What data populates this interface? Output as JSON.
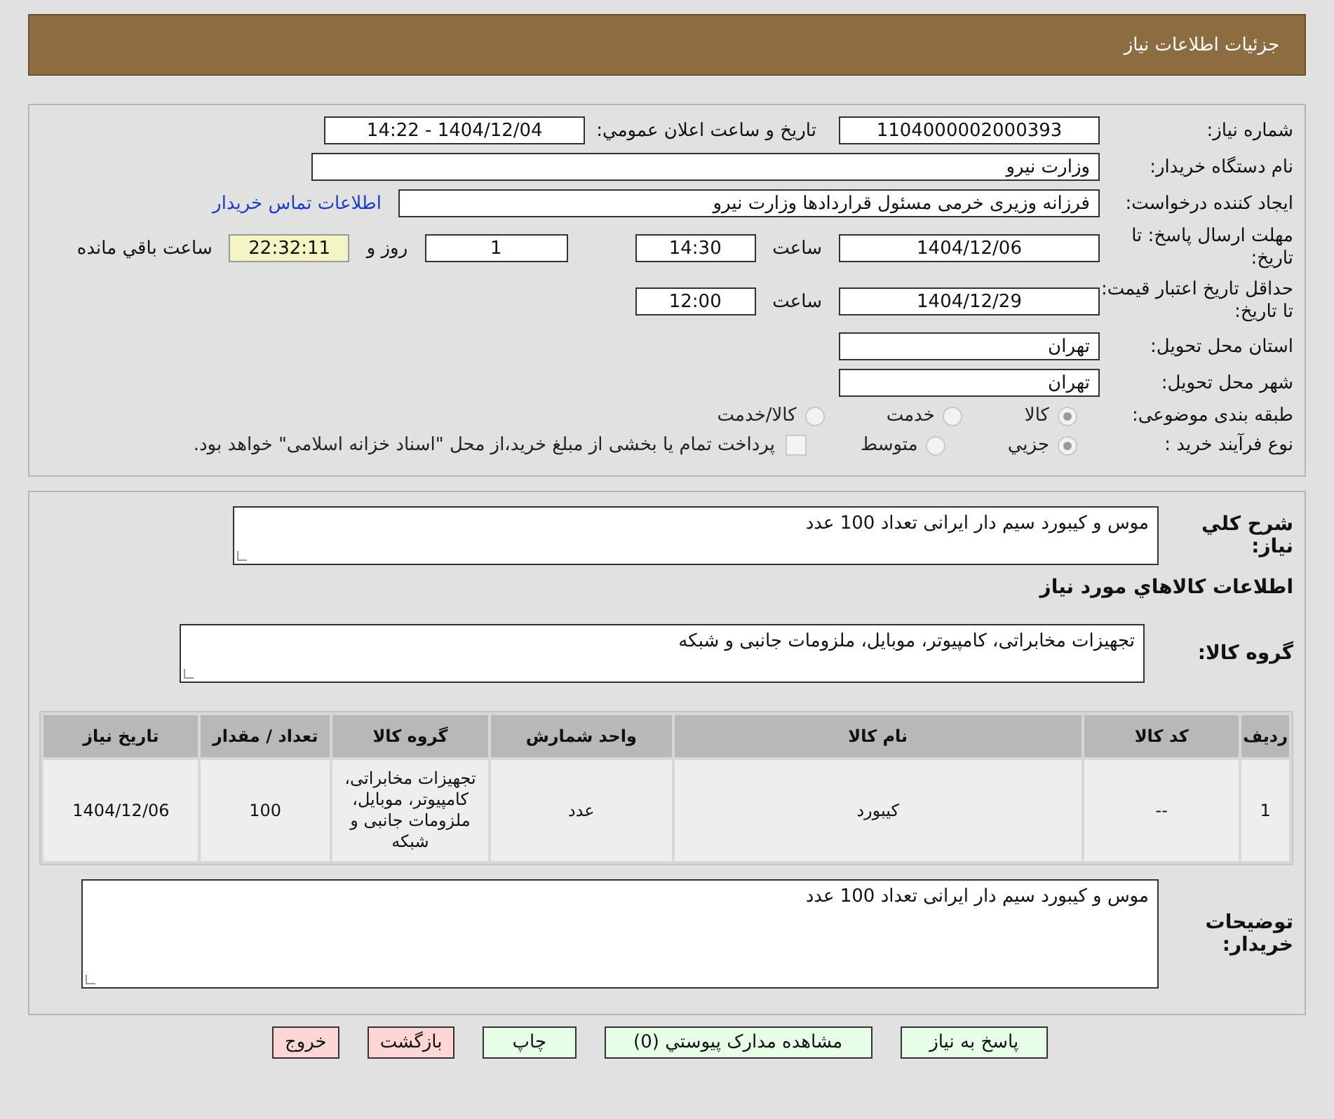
{
  "header": {
    "title": "جزئیات اطلاعات نیاز"
  },
  "details": {
    "need_number": {
      "label": "شماره نياز:",
      "value": "1104000002000393"
    },
    "announce": {
      "label": "تاريخ و ساعت اعلان عمومي:",
      "value": "1404/12/04 - 14:22"
    },
    "buyer": {
      "label": "نام دستگاه خريدار:",
      "value": "وزارت نيرو"
    },
    "creator": {
      "label": "ايجاد کننده درخواست:",
      "value": "فرزانه وزیری خرمی مسئول قراردادها وزارت نيرو",
      "link": "اطلاعات تماس خريدار"
    },
    "deadline": {
      "label": "مهلت ارسال پاسخ: تا تاريخ:",
      "date": "1404/12/06",
      "time_label": "ساعت",
      "time": "14:30",
      "days": "1",
      "days_label": "روز و",
      "remaining": "22:32:11",
      "remaining_label": "ساعت باقي مانده"
    },
    "validity": {
      "label": "حداقل تاريخ اعتبار قيمت: تا تاريخ:",
      "date": "1404/12/29",
      "time_label": "ساعت",
      "time": "12:00"
    },
    "province": {
      "label": "استان محل تحويل:",
      "value": "تهران"
    },
    "city": {
      "label": "شهر محل تحويل:",
      "value": "تهران"
    },
    "category": {
      "label": "طبقه بندی موضوعی:",
      "options": [
        {
          "label": "کالا",
          "selected": true
        },
        {
          "label": "خدمت",
          "selected": false
        },
        {
          "label": "کالا/خدمت",
          "selected": false
        }
      ]
    },
    "process": {
      "label": "نوع فرآیند خرید :",
      "options": [
        {
          "label": "جزيي",
          "selected": true
        },
        {
          "label": "متوسط",
          "selected": false
        }
      ],
      "payment": {
        "checked": false,
        "label": "پرداخت تمام یا بخشی از مبلغ خرید،از محل \"اسناد خزانه اسلامی\" خواهد بود."
      }
    }
  },
  "goods": {
    "summary": {
      "label": "شرح كلي نياز:",
      "value": "موس و کیبورد سیم دار ایرانی تعداد 100 عدد"
    },
    "heading": "اطلاعات كالاهاي مورد نياز",
    "group": {
      "label": "گروه کالا:",
      "value": "تجهیزات مخابراتی، کامپیوتر، موبایل، ملزومات جانبی و شبکه"
    },
    "table": {
      "columns": [
        "رديف",
        "کد کالا",
        "نام کالا",
        "واحد شمارش",
        "گروه کالا",
        "تعداد / مقدار",
        "تاريخ نياز"
      ],
      "rows": [
        [
          "1",
          "--",
          "کیبورد",
          "عدد",
          "تجهیزات مخابراتی، کامپیوتر، موبایل، ملزومات جانبی و شبکه",
          "100",
          "1404/12/06"
        ]
      ]
    },
    "notes": {
      "label": "توضيحات خريدار:",
      "value": "موس و کیبورد سیم دار ایرانی تعداد 100 عدد"
    }
  },
  "buttons": [
    {
      "label": "پاسخ به نياز",
      "kind": "primary"
    },
    {
      "label": "مشاهده مدارک پيوستي (0)",
      "kind": "primary"
    },
    {
      "label": "چاپ",
      "kind": "primary"
    },
    {
      "label": "بازگشت",
      "kind": "danger"
    },
    {
      "label": "خروج",
      "kind": "danger"
    }
  ]
}
